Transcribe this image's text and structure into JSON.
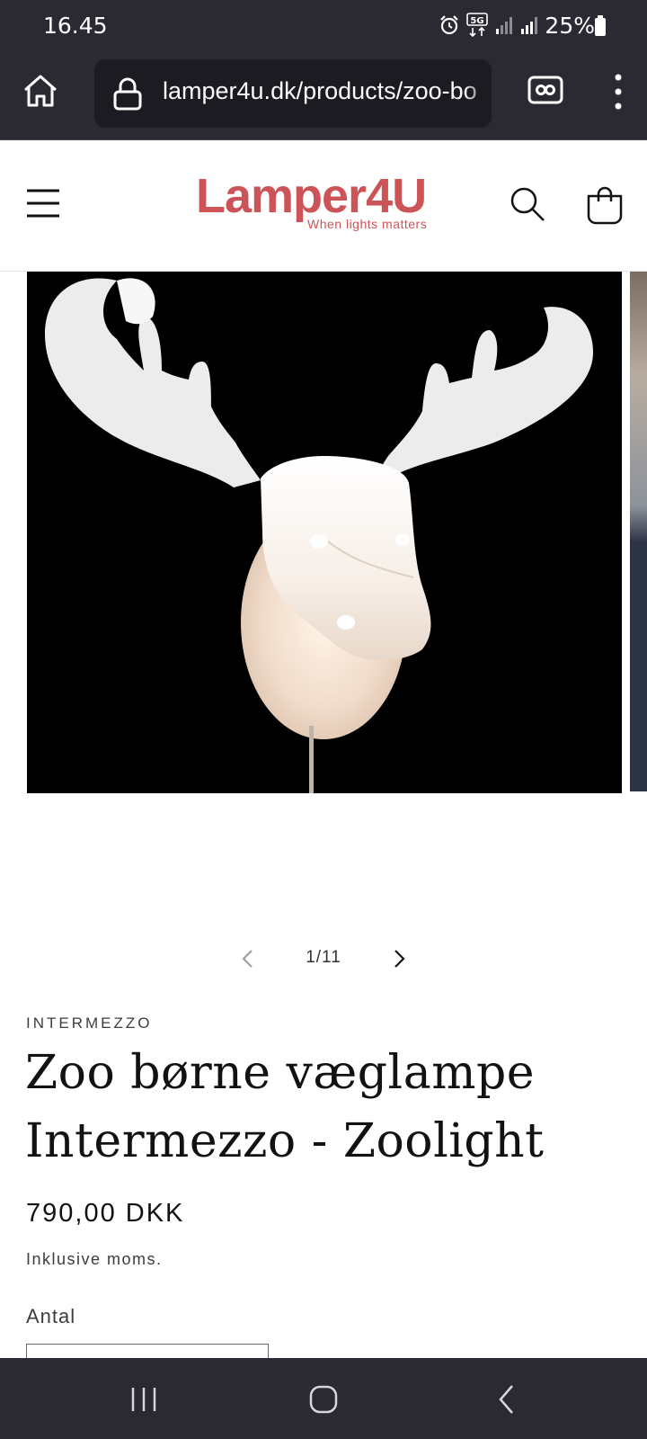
{
  "status_bar": {
    "time": "16.45",
    "network": "5G",
    "battery": "25%"
  },
  "browser": {
    "url": "lamper4u.dk/products/zoo-bo",
    "icons": [
      "home-icon",
      "lock-icon",
      "reader-view-icon",
      "more-vertical-icon"
    ]
  },
  "header": {
    "logo_text": "Lamper4U",
    "logo_tagline": "When lights matters",
    "brand_color": "#cc5357",
    "icons": [
      "menu-icon",
      "search-icon",
      "cart-icon"
    ]
  },
  "gallery": {
    "counter": "1/11",
    "image": "moose-head-wall-lamp",
    "icons": [
      "chevron-left-icon",
      "chevron-right-icon"
    ]
  },
  "product": {
    "vendor": "INTERMEZZO",
    "title": "Zoo børne væglampe Intermezzo - Zoolight",
    "price": "790,00 DKK",
    "tax_note": "Inklusive moms.",
    "quantity_label": "Antal"
  },
  "system_nav": {
    "icons": [
      "recents-icon",
      "home-circle-icon",
      "back-icon"
    ]
  }
}
